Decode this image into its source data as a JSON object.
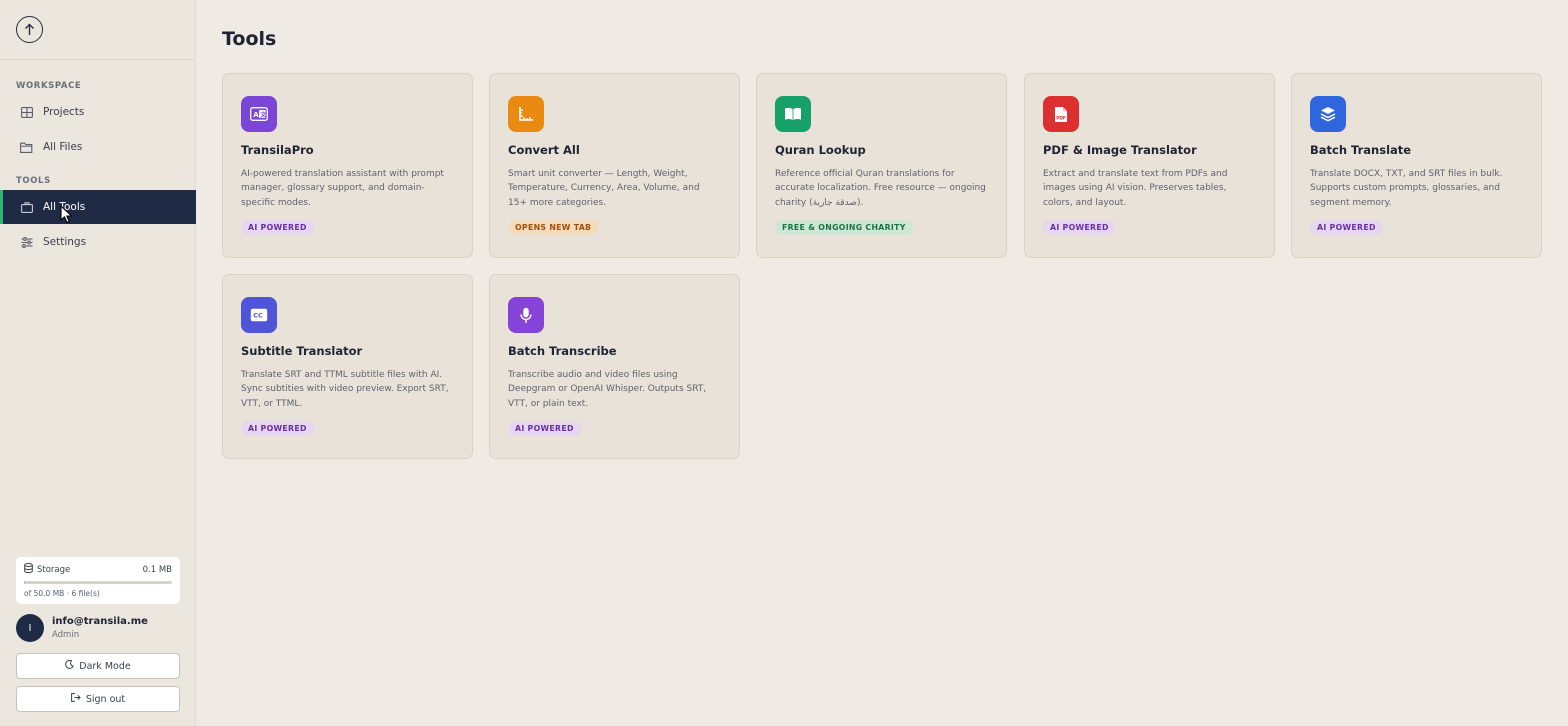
{
  "sidebar": {
    "workspace_label": "WORKSPACE",
    "tools_label": "TOOLS",
    "nav": {
      "projects": "Projects",
      "all_files": "All Files",
      "all_tools": "All Tools",
      "settings": "Settings"
    },
    "storage": {
      "title": "Storage",
      "used": "0.1 MB",
      "sub": "of 50.0 MB · 6 file(s)",
      "fraction": 0.002
    },
    "user": {
      "initial": "I",
      "email": "info@transila.me",
      "role": "Admin"
    },
    "dark_mode_label": "Dark Mode",
    "sign_out_label": "Sign out"
  },
  "main": {
    "title": "Tools",
    "cards": [
      {
        "title": "TransilaPro",
        "desc": "AI-powered translation assistant with prompt manager, glossary support, and domain-specific modes.",
        "badge": "AI POWERED",
        "icon": "translate-icon",
        "color": "#7b45d6"
      },
      {
        "title": "Convert All",
        "desc": "Smart unit converter — Length, Weight, Temperature, Currency, Area, Volume, and 15+ more categories.",
        "badge": "OPENS NEW TAB",
        "icon": "ruler-icon",
        "color": "#ea8a10"
      },
      {
        "title": "Quran Lookup",
        "desc": "Reference official Quran translations for accurate localization. Free resource — ongoing charity (صدقة جارية).",
        "badge": "FREE & ONGOING CHARITY",
        "icon": "book-icon",
        "color": "#16a06a"
      },
      {
        "title": "PDF & Image Translator",
        "desc": "Extract and translate text from PDFs and images using AI vision. Preserves tables, colors, and layout.",
        "badge": "AI POWERED",
        "icon": "pdf-icon",
        "color": "#dc3030"
      },
      {
        "title": "Batch Translate",
        "desc": "Translate DOCX, TXT, and SRT files in bulk. Supports custom prompts, glossaries, and segment memory.",
        "badge": "AI POWERED",
        "icon": "layers-icon",
        "color": "#2f66dd"
      },
      {
        "title": "Subtitle Translator",
        "desc": "Translate SRT and TTML subtitle files with AI. Sync subtities with video preview. Export SRT, VTT, or TTML.",
        "badge": "AI POWERED",
        "icon": "cc-icon",
        "color": "#4f55d9"
      },
      {
        "title": "Batch Transcribe",
        "desc": "Transcribe audio and video files using Deepgram or OpenAI Whisper. Outputs SRT, VTT, or plain text.",
        "badge": "AI POWERED",
        "icon": "microphone-icon",
        "color": "#8543d8"
      }
    ]
  }
}
